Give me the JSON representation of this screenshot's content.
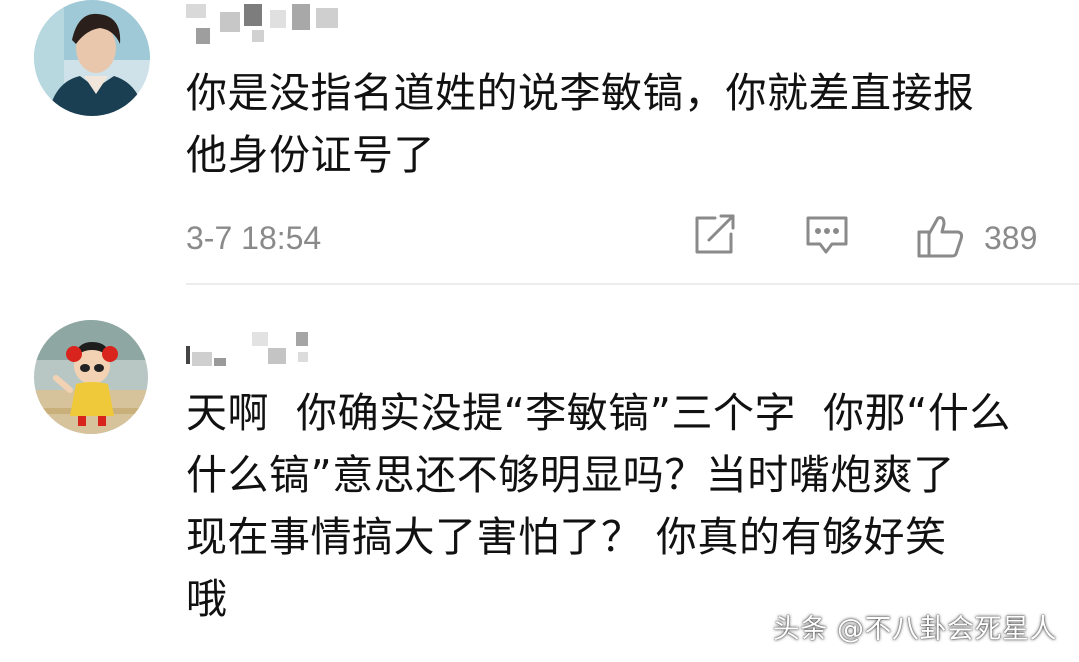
{
  "comments": [
    {
      "text": "你是没指名道姓的说李敏镐，你就差直接报\n他身份证号了",
      "timestamp": "3-7 18:54",
      "likes": "389"
    },
    {
      "text": "天啊  你确实没提“李敏镐”三个字  你那“什么\n什么镐”意思还不够明显吗？当时嘴炮爽了\n现在事情搞大了害怕了？ 你真的有够好笑\n哦"
    }
  ],
  "icons": {
    "share": "share-icon",
    "reply": "comment-icon",
    "like": "thumbs-up-icon"
  },
  "watermark": "头条 @不八卦会死星人",
  "colors": {
    "text": "#111111",
    "meta": "#8a8a8a",
    "divider": "#ececec"
  }
}
